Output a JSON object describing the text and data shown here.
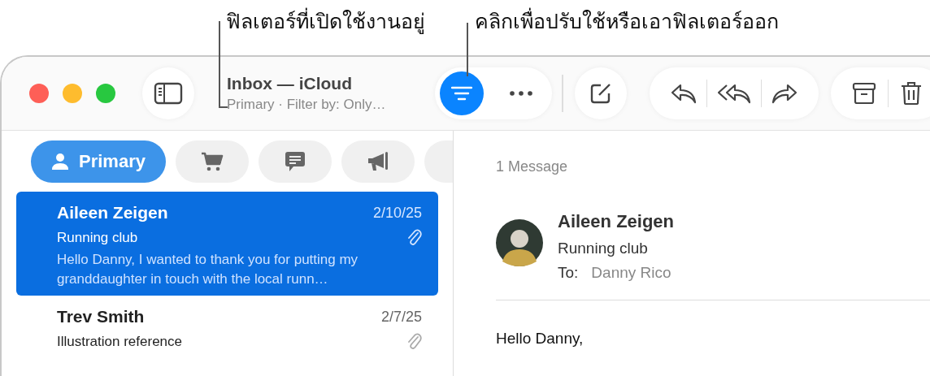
{
  "annotations": [
    {
      "text": "ฟิลเตอร์ที่เปิดใช้งานอยู่"
    },
    {
      "text": "คลิกเพื่อปรับใช้หรือเอาฟิลเตอร์ออก"
    }
  ],
  "window": {
    "title": "Inbox — iCloud",
    "subtitle": "Primary · Filter by: Only…"
  },
  "toolbar": {
    "filter_on": true
  },
  "categories": [
    {
      "kind": "person",
      "label": "Primary",
      "selected": true
    },
    {
      "kind": "cart",
      "selected": false
    },
    {
      "kind": "chat",
      "selected": false
    },
    {
      "kind": "megaphone",
      "selected": false
    },
    {
      "kind": "other",
      "selected": false
    }
  ],
  "messages": [
    {
      "sender": "Aileen Zeigen",
      "date": "2/10/25",
      "subject": "Running club",
      "preview": "Hello Danny, I wanted to thank you for putting my granddaughter in touch with the local runn…",
      "attachment": true,
      "selected": true
    },
    {
      "sender": "Trev Smith",
      "date": "2/7/25",
      "subject": "Illustration reference",
      "attachment": true,
      "selected": false
    }
  ],
  "reader": {
    "count": "1 Message",
    "sender": "Aileen Zeigen",
    "subject": "Running club",
    "to_label": "To:",
    "to": "Danny Rico",
    "body": "Hello Danny,"
  }
}
